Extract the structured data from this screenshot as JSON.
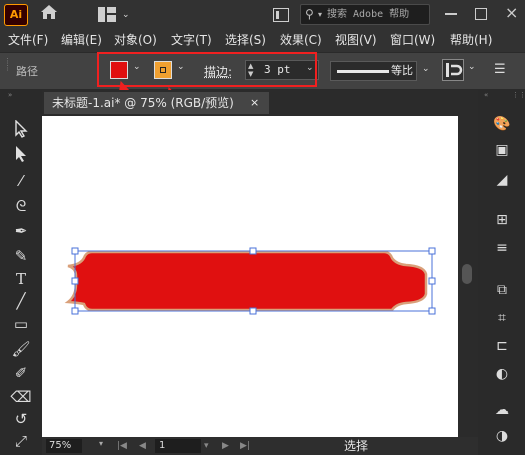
{
  "app": {
    "logo": "Ai"
  },
  "titlebar": {
    "home_icon": "home-icon",
    "workspace_icon": "layout-grid-icon",
    "panel_icon": "panel-toggle-icon",
    "search_placeholder": "搜索 Adobe 帮助"
  },
  "menu": [
    {
      "label": "文件(F)"
    },
    {
      "label": "编辑(E)"
    },
    {
      "label": "对象(O)"
    },
    {
      "label": "文字(T)"
    },
    {
      "label": "选择(S)"
    },
    {
      "label": "效果(C)"
    },
    {
      "label": "视图(V)"
    },
    {
      "label": "窗口(W)"
    },
    {
      "label": "帮助(H)"
    }
  ],
  "control": {
    "selection_label": "路径",
    "fill_color": "#e01010",
    "stroke_color": "#f0a030",
    "stroke_label": "描边",
    "stroke_colon": ":",
    "stroke_weight": "3 pt",
    "profile_label": "等比",
    "highlight_color": "#f02020"
  },
  "document": {
    "tab_label": "未标题-1.ai* @ 75% (RGB/预览)",
    "close": "×"
  },
  "artwork": {
    "fill": "#e01010",
    "stroke": "#d9a07a",
    "selection_color": "#4a72d8"
  },
  "status": {
    "zoom": "75%",
    "page": "1",
    "tool": "选择"
  }
}
